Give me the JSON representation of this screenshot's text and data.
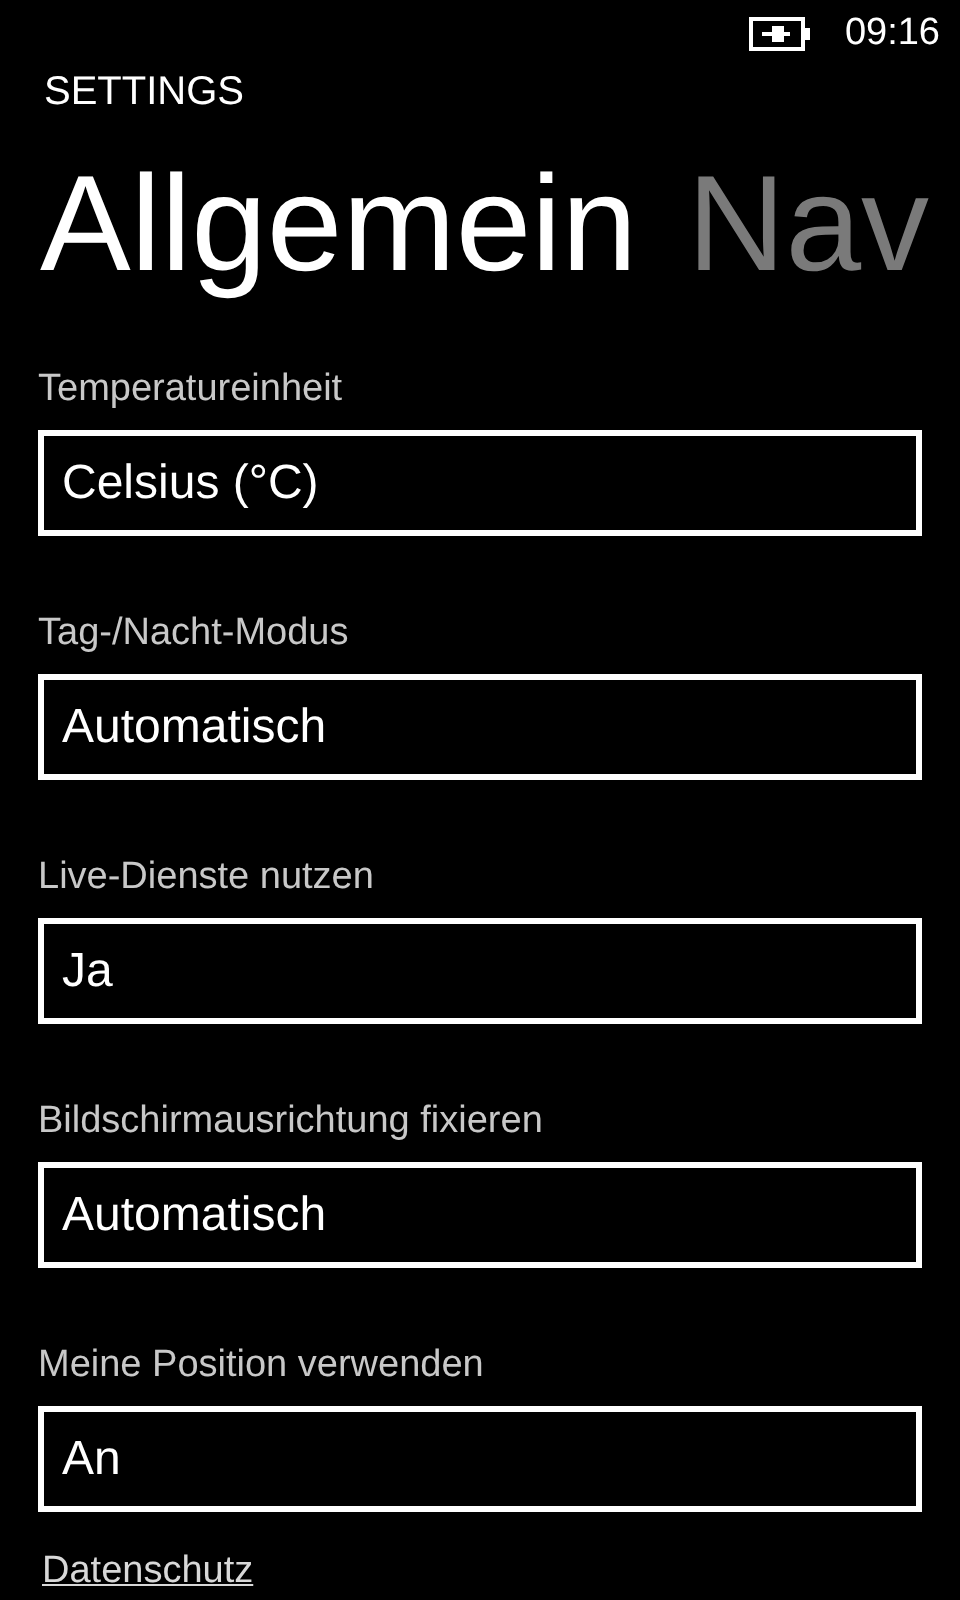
{
  "status_bar": {
    "time": "09:16"
  },
  "app_title": "SETTINGS",
  "pivot": [
    {
      "label": "Allgemein",
      "selected": true
    },
    {
      "label": "Nav",
      "selected": false
    }
  ],
  "settings": [
    {
      "label": "Temperatureinheit",
      "value": "Celsius (°C)"
    },
    {
      "label": "Tag-/Nacht-Modus",
      "value": "Automatisch"
    },
    {
      "label": "Live-Dienste nutzen",
      "value": "Ja"
    },
    {
      "label": "Bildschirmausrichtung fixieren",
      "value": "Automatisch"
    },
    {
      "label": "Meine Position verwenden",
      "value": "An"
    }
  ],
  "privacy_link": "Datenschutz"
}
